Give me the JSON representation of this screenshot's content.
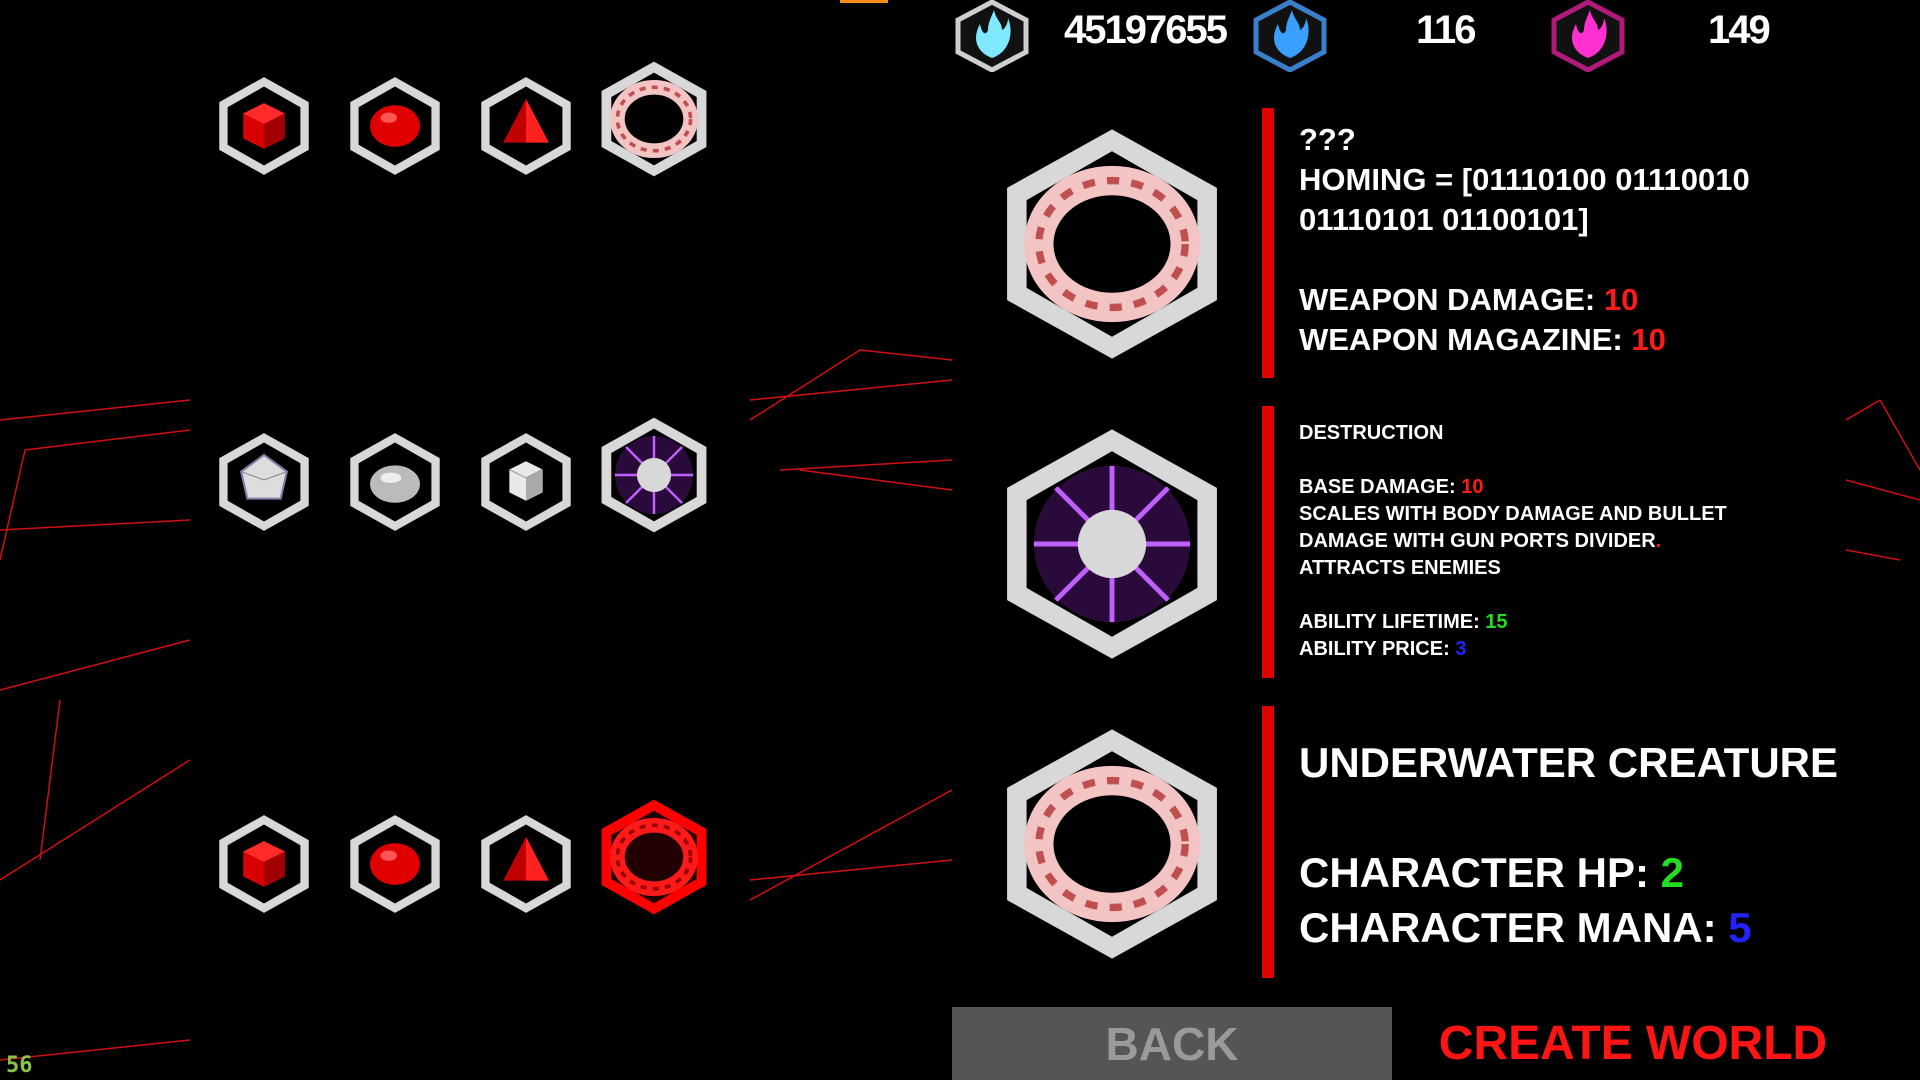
{
  "fps": "56",
  "currencies": [
    {
      "icon": "cyan-flame-emblem-icon",
      "value": "45197655",
      "color": "#7fe9ff"
    },
    {
      "icon": "blue-flame-emblem-icon",
      "value": "116",
      "color": "#3aa0ff"
    },
    {
      "icon": "magenta-flame-emblem-icon",
      "value": "149",
      "color": "#ff2fd0"
    }
  ],
  "grid": {
    "rows": [
      [
        "red-cube",
        "red-sphere",
        "red-pyramid",
        "swirl-torus"
      ],
      [
        "crystal-gem",
        "metal-orb",
        "white-cube",
        "purple-tentacle-orb"
      ],
      [
        "red-cube",
        "red-sphere",
        "red-pyramid",
        "red-swirl-selected"
      ]
    ]
  },
  "weapon": {
    "name": "???",
    "homing_label": "HOMING = ",
    "homing_value": "[01110100 01110010 01110101 01100101]",
    "damage_label": "WEAPON DAMAGE: ",
    "damage_value": "10",
    "magazine_label": "WEAPON MAGAZINE: ",
    "magazine_value": "10"
  },
  "ability": {
    "name": "DESTRUCTION",
    "base_damage_label": "BASE DAMAGE: ",
    "base_damage_value": "10",
    "desc_line1": "SCALES WITH BODY DAMAGE AND BULLET",
    "desc_line2": "DAMAGE WITH GUN PORTS DIVIDER",
    "desc_line2_suffix": ".",
    "desc_line3": "ATTRACTS ENEMIES",
    "lifetime_label": "ABILITY LIFETIME: ",
    "lifetime_value": "15",
    "price_label": "ABILITY PRICE: ",
    "price_value": "3"
  },
  "character": {
    "name": "UNDERWATER CREATURE",
    "hp_label": "CHARACTER HP: ",
    "hp_value": "2",
    "mana_label": "CHARACTER MANA: ",
    "mana_value": "5"
  },
  "buttons": {
    "back": "BACK",
    "create": "CREATE WORLD"
  },
  "colors": {
    "accent_red": "#e00000",
    "value_green": "#22dd22",
    "value_blue": "#2222ff",
    "value_red": "#ff1a1a"
  }
}
